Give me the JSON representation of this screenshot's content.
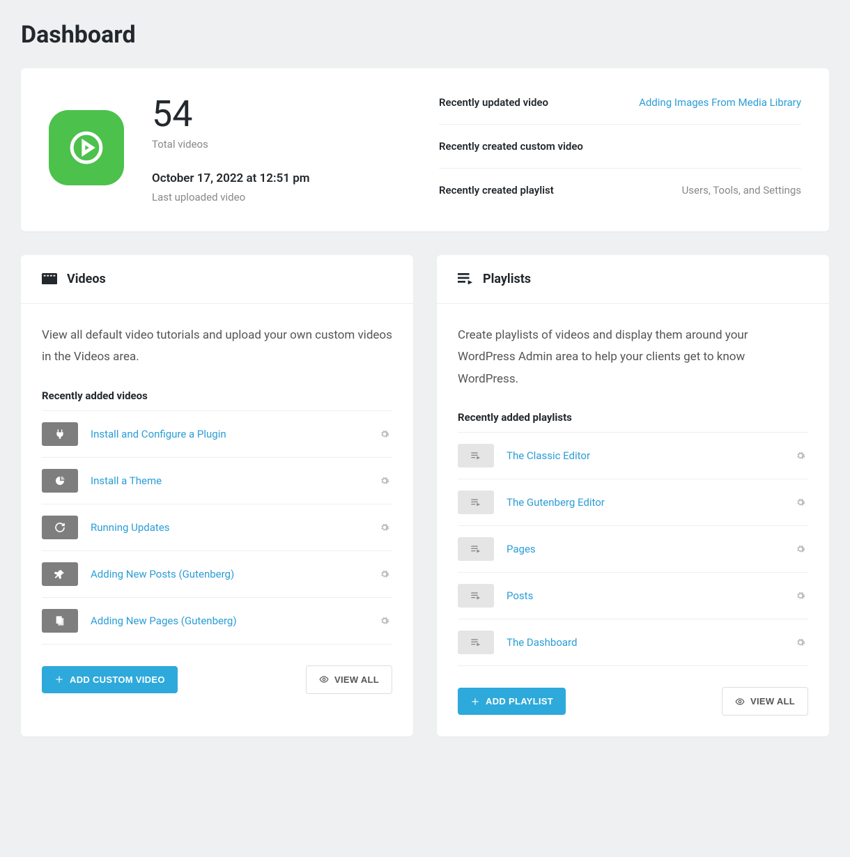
{
  "page_title": "Dashboard",
  "stats": {
    "total_videos": "54",
    "total_videos_label": "Total videos",
    "last_upload_time": "October 17, 2022 at 12:51 pm",
    "last_upload_label": "Last uploaded video"
  },
  "recent": [
    {
      "label": "Recently updated video",
      "value": "Adding Images From Media Library",
      "link": true
    },
    {
      "label": "Recently created custom video",
      "value": "",
      "link": false
    },
    {
      "label": "Recently created playlist",
      "value": "Users, Tools, and Settings",
      "link": false
    }
  ],
  "videos_panel": {
    "title": "Videos",
    "description": "View all default video tutorials and upload your own custom videos in the Videos area.",
    "list_heading": "Recently added videos",
    "items": [
      {
        "title": "Install and Configure a Plugin",
        "icon": "plug"
      },
      {
        "title": "Install a Theme",
        "icon": "dashboard"
      },
      {
        "title": "Running Updates",
        "icon": "refresh"
      },
      {
        "title": "Adding New Posts (Gutenberg)",
        "icon": "pin"
      },
      {
        "title": "Adding New Pages (Gutenberg)",
        "icon": "pages"
      }
    ],
    "add_button": "Add Custom Video",
    "view_all_button": "View All"
  },
  "playlists_panel": {
    "title": "Playlists",
    "description": "Create playlists of videos and display them around your WordPress Admin area to help your clients get to know WordPress.",
    "list_heading": "Recently added playlists",
    "items": [
      {
        "title": "The Classic Editor"
      },
      {
        "title": "The Gutenberg Editor"
      },
      {
        "title": "Pages"
      },
      {
        "title": "Posts"
      },
      {
        "title": "The Dashboard"
      }
    ],
    "add_button": "Add Playlist",
    "view_all_button": "View All"
  }
}
